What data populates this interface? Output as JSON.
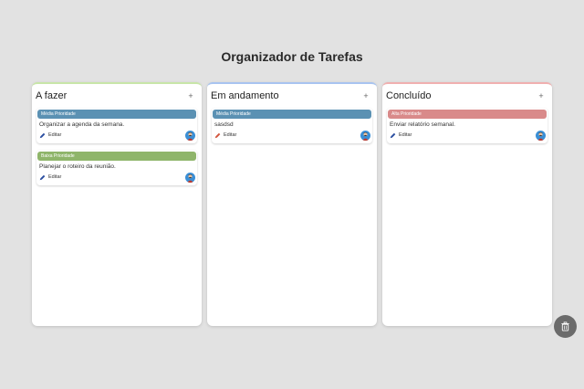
{
  "page": {
    "title": "Organizador de Tarefas"
  },
  "columns": [
    {
      "title": "A fazer",
      "add_label": "+",
      "accent": "#c8e6a8",
      "cards": [
        {
          "priority": "Média Prioridade",
          "priority_color": "#5b91b3",
          "text": "Organizar a agenda da semana.",
          "edit_label": "Editar",
          "edit_color": "#2b4ea0"
        },
        {
          "priority": "Baixa Prioridade",
          "priority_color": "#8fb56a",
          "text": "Planejar o roteiro da reunião.",
          "edit_label": "Editar",
          "edit_color": "#2b4ea0"
        }
      ]
    },
    {
      "title": "Em andamento",
      "add_label": "+",
      "accent": "#a8c4f0",
      "cards": [
        {
          "priority": "Média Prioridade",
          "priority_color": "#5b91b3",
          "text": "sasdsd",
          "edit_label": "Editar",
          "edit_color": "#d2543c"
        }
      ]
    },
    {
      "title": "Concluído",
      "add_label": "+",
      "accent": "#f0b0b0",
      "cards": [
        {
          "priority": "Alta Prioridade",
          "priority_color": "#d98a8a",
          "text": "Enviar relatório semanal.",
          "edit_label": "Editar",
          "edit_color": "#2b4ea0"
        }
      ]
    }
  ],
  "icons": {
    "edit": "pencil-icon",
    "avatar": "user-avatar-icon",
    "trash": "trash-icon"
  }
}
